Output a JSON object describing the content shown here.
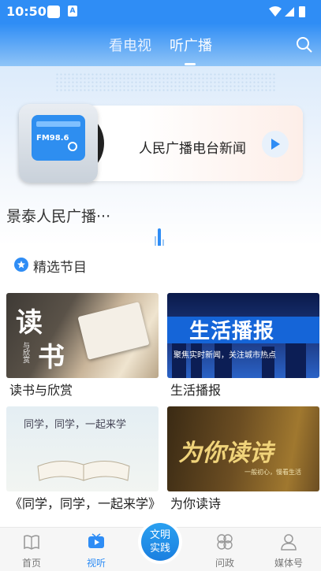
{
  "status_bar": {
    "time": "10:50"
  },
  "header": {
    "tabs": [
      {
        "label": "看电视",
        "active": false
      },
      {
        "label": "听广播",
        "active": true
      }
    ]
  },
  "player": {
    "fm_label": "FM98.6",
    "station_name": "人民广播电台新闻",
    "now_playing": "景泰人民广播···"
  },
  "section": {
    "title": "精选节目"
  },
  "programs": [
    {
      "title": "读书与欣赏",
      "thumb_text": "读",
      "thumb_text2": "书",
      "thumb_small": "与欣赏"
    },
    {
      "title": "生活播报",
      "thumb_text": "生活播报",
      "thumb_sub": "聚焦实时新闻，关注城市热点"
    },
    {
      "title": "《同学，同学，一起来学》",
      "thumb_text": "同学，同学，一起来学"
    },
    {
      "title": "为你读诗",
      "thumb_text": "为你读诗",
      "thumb_sub": "一般初心，慢看生活"
    }
  ],
  "nav": {
    "items": [
      {
        "label": "首页",
        "icon": "book-icon"
      },
      {
        "label": "视听",
        "icon": "tv-play-icon",
        "active": true
      },
      {
        "label": "问政",
        "icon": "flower-icon"
      },
      {
        "label": "媒体号",
        "icon": "person-icon"
      }
    ],
    "center_label_line1": "文明",
    "center_label_line2": "实践"
  },
  "colors": {
    "accent": "#2f8df5"
  }
}
